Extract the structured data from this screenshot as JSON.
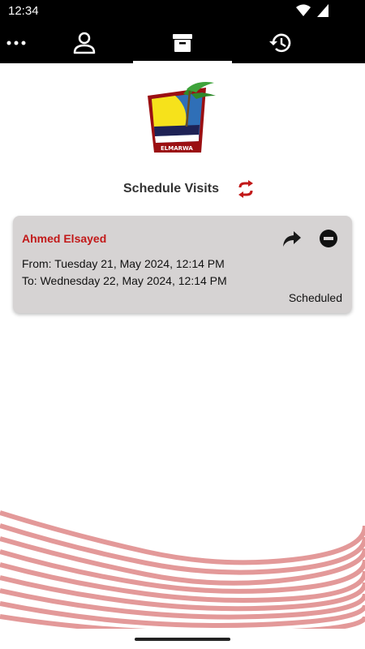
{
  "status_bar": {
    "time": "12:34"
  },
  "nav": {
    "items": [
      {
        "icon": "more-icon"
      },
      {
        "icon": "profile-icon"
      },
      {
        "icon": "archive-icon",
        "active": true
      },
      {
        "icon": "history-icon"
      }
    ]
  },
  "logo": {
    "text": "ELMARWA"
  },
  "page": {
    "title": "Schedule Visits",
    "refresh_icon": "refresh-icon"
  },
  "visits": [
    {
      "name": "Ahmed Elsayed",
      "from": "From: Tuesday 21, May 2024, 12:14 PM",
      "to": "To: Wednesday 22, May 2024, 12:14 PM",
      "status": "Scheduled",
      "actions": [
        "forward-icon",
        "remove-icon"
      ]
    }
  ],
  "colors": {
    "accent_red": "#c21919",
    "card_bg": "#d6d3d3",
    "nav_bg": "#000000",
    "wave": "#e39999"
  }
}
